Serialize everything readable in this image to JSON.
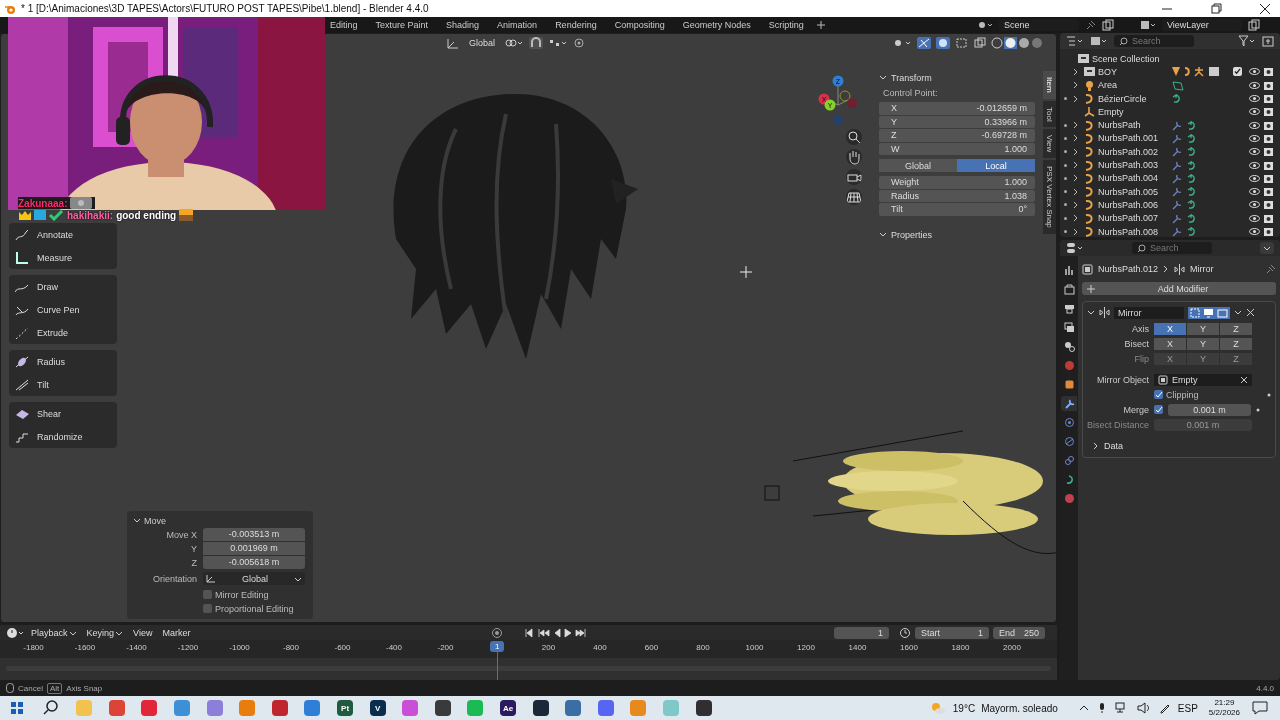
{
  "window": {
    "title": "* 1 [D:\\Animaciones\\3D TAPES\\Actors\\FUTURO POST TAPES\\Pibe\\1.blend] - Blender 4.4.0"
  },
  "workspaces": [
    {
      "label": "Editing",
      "selected": false
    },
    {
      "label": "Texture Paint",
      "selected": false
    },
    {
      "label": "Shading",
      "selected": false
    },
    {
      "label": "Animation",
      "selected": false
    },
    {
      "label": "Rendering",
      "selected": false
    },
    {
      "label": "Compositing",
      "selected": false
    },
    {
      "label": "Geometry Nodes",
      "selected": false
    },
    {
      "label": "Scripting",
      "selected": false
    }
  ],
  "scene": "Scene",
  "view_layer": "ViewLayer",
  "viewport": {
    "orientation": "Global",
    "tool_groups": [
      {
        "tools": [
          {
            "label": "Annotate",
            "kind": "annotate"
          },
          {
            "label": "Measure",
            "kind": "measure"
          }
        ]
      },
      {
        "tools": [
          {
            "label": "Draw",
            "kind": "draw"
          },
          {
            "label": "Curve Pen",
            "kind": "pen"
          },
          {
            "label": "Extrude",
            "kind": "extrude"
          }
        ]
      },
      {
        "tools": [
          {
            "label": "Radius",
            "kind": "radius"
          },
          {
            "label": "Tilt",
            "kind": "tilt"
          }
        ]
      },
      {
        "tools": [
          {
            "label": "Shear",
            "kind": "shear"
          },
          {
            "label": "Randomize",
            "kind": "randomize"
          }
        ]
      }
    ],
    "gizmo": [
      {
        "label": "Z",
        "color": "#2f7fd6"
      },
      {
        "label": "X",
        "color": "#d6304b"
      },
      {
        "label": "Y",
        "color": "#86d12a"
      }
    ],
    "sidebar_tabs": [
      {
        "label": "Item",
        "selected": true
      },
      {
        "label": "Tool",
        "selected": false
      },
      {
        "label": "View",
        "selected": false
      },
      {
        "label": "PSX Vertex Snap",
        "selected": false
      }
    ],
    "transform": {
      "title": "Transform",
      "subtitle": "Control Point:",
      "coords": [
        {
          "label": "X",
          "value": "-0.012659 m"
        },
        {
          "label": "Y",
          "value": "0.33966 m"
        },
        {
          "label": "Z",
          "value": "-0.69728 m"
        },
        {
          "label": "W",
          "value": "1.000"
        }
      ],
      "space": [
        {
          "label": "Global",
          "selected": false
        },
        {
          "label": "Local",
          "selected": true
        }
      ],
      "extras": [
        {
          "label": "Weight",
          "value": "1.000"
        },
        {
          "label": "Radius",
          "value": "1.038"
        },
        {
          "label": "Tilt",
          "value": "0°"
        }
      ]
    },
    "properties_title": "Properties",
    "operator": {
      "title": "Move",
      "fields": [
        {
          "label": "Move X",
          "value": "-0.003513 m"
        },
        {
          "label": "Y",
          "value": "0.001969 m"
        },
        {
          "label": "Z",
          "value": "-0.005618 m"
        }
      ],
      "orientation_label": "Orientation",
      "orientation": "Global",
      "options": [
        {
          "label": "Mirror Editing",
          "checked": false
        },
        {
          "label": "Proportional Editing",
          "checked": false
        }
      ]
    }
  },
  "chat": [
    {
      "user": "Zakunaaa:"
    },
    {
      "user": "hakihakii:",
      "message": "good ending"
    }
  ],
  "outliner": {
    "search_placeholder": "Search",
    "root": "Scene Collection",
    "items": [
      {
        "name": "BOY",
        "kind": "collection",
        "has_modifiers": false,
        "checked": true
      },
      {
        "name": "Area",
        "kind": "light",
        "has_modifiers": false
      },
      {
        "name": "BézierCircle",
        "kind": "curve",
        "has_modifiers": false
      },
      {
        "name": "Empty",
        "kind": "empty",
        "has_modifiers": false
      },
      {
        "name": "NurbsPath",
        "kind": "curve",
        "has_modifiers": true
      },
      {
        "name": "NurbsPath.001",
        "kind": "curve",
        "has_modifiers": true
      },
      {
        "name": "NurbsPath.002",
        "kind": "curve",
        "has_modifiers": true
      },
      {
        "name": "NurbsPath.003",
        "kind": "curve",
        "has_modifiers": true
      },
      {
        "name": "NurbsPath.004",
        "kind": "curve",
        "has_modifiers": true
      },
      {
        "name": "NurbsPath.005",
        "kind": "curve",
        "has_modifiers": true
      },
      {
        "name": "NurbsPath.006",
        "kind": "curve",
        "has_modifiers": true
      },
      {
        "name": "NurbsPath.007",
        "kind": "curve",
        "has_modifiers": true
      },
      {
        "name": "NurbsPath.008",
        "kind": "curve",
        "has_modifiers": true
      }
    ]
  },
  "properties": {
    "search_placeholder": "Search",
    "tabs": [
      {
        "kind": "tool",
        "selected": false
      },
      {
        "kind": "render",
        "selected": false
      },
      {
        "kind": "output",
        "selected": false
      },
      {
        "kind": "view_layer",
        "selected": false
      },
      {
        "kind": "scene",
        "selected": false
      },
      {
        "kind": "world",
        "selected": false
      },
      {
        "kind": "object",
        "selected": false
      },
      {
        "kind": "modifier",
        "selected": true
      },
      {
        "kind": "particles",
        "selected": false
      },
      {
        "kind": "physics",
        "selected": false
      },
      {
        "kind": "constraints",
        "selected": false
      },
      {
        "kind": "data",
        "selected": false
      },
      {
        "kind": "material",
        "selected": false
      }
    ],
    "object": "NurbsPath.012",
    "modifier_crumb": "Mirror",
    "add_label": "Add Modifier",
    "modifier": {
      "name": "Mirror",
      "rows": [
        {
          "label": "Axis",
          "disabled": false,
          "buttons": [
            {
              "label": "X",
              "on": true
            },
            {
              "label": "Y",
              "on": false
            },
            {
              "label": "Z",
              "on": false
            }
          ]
        },
        {
          "label": "Bisect",
          "disabled": false,
          "buttons": [
            {
              "label": "X",
              "on": false
            },
            {
              "label": "Y",
              "on": false
            },
            {
              "label": "Z",
              "on": false
            }
          ]
        },
        {
          "label": "Flip",
          "disabled": true,
          "buttons": [
            {
              "label": "X",
              "on": false
            },
            {
              "label": "Y",
              "on": false
            },
            {
              "label": "Z",
              "on": false
            }
          ]
        }
      ],
      "mirror_object_label": "Mirror Object",
      "mirror_object": "Empty",
      "clipping": {
        "label": "Clipping",
        "checked": true
      },
      "merge": {
        "label": "Merge",
        "checked": true,
        "value": "0.001 m"
      },
      "bisect_distance": {
        "label": "Bisect Distance",
        "value": "0.001 m",
        "disabled": true
      },
      "data_label": "Data"
    }
  },
  "timeline": {
    "menus": [
      "Playback",
      "Keying",
      "View",
      "Marker"
    ],
    "current_frame": "1",
    "start_label": "Start",
    "start": "1",
    "end_label": "End",
    "end": "250",
    "playhead": "1",
    "ruler": [
      "-1800",
      "-1600",
      "-1400",
      "-1200",
      "-1000",
      "-800",
      "-600",
      "-400",
      "-200",
      "200",
      "400",
      "600",
      "800",
      "1000",
      "1200",
      "1400",
      "1600",
      "1800",
      "2000"
    ]
  },
  "status": {
    "cancel": "Cancel",
    "key": "Alt",
    "hint": "Axis Snap",
    "version": "4.4.0"
  },
  "taskbar": {
    "apps": [
      {
        "color": "#f2c14e"
      },
      {
        "color": "#db4437"
      },
      {
        "color": "#e1263a"
      },
      {
        "color": "#3d8fd6"
      },
      {
        "color": "#8b7fd9"
      },
      {
        "color": "#e87d0d"
      },
      {
        "color": "#c0262d"
      },
      {
        "color": "#2f7fd6"
      },
      {
        "color": "#1f5c3f",
        "label": "Pt"
      },
      {
        "color": "#0b2d4d",
        "label": "V"
      },
      {
        "color": "#c94fd6"
      },
      {
        "color": "#3a3a3a"
      },
      {
        "color": "#1db954"
      },
      {
        "color": "#2a1a5e",
        "label": "Ae"
      },
      {
        "color": "#1b2838"
      },
      {
        "color": "#3a6ea5"
      },
      {
        "color": "#5865f2"
      },
      {
        "color": "#e8891d"
      },
      {
        "color": "#7fc8c8"
      },
      {
        "color": "#302e31"
      }
    ],
    "weather": "19°C",
    "forecast": "Mayorm. soleado",
    "language": "ESP",
    "time": "21:29",
    "date": "5/2/2026"
  }
}
